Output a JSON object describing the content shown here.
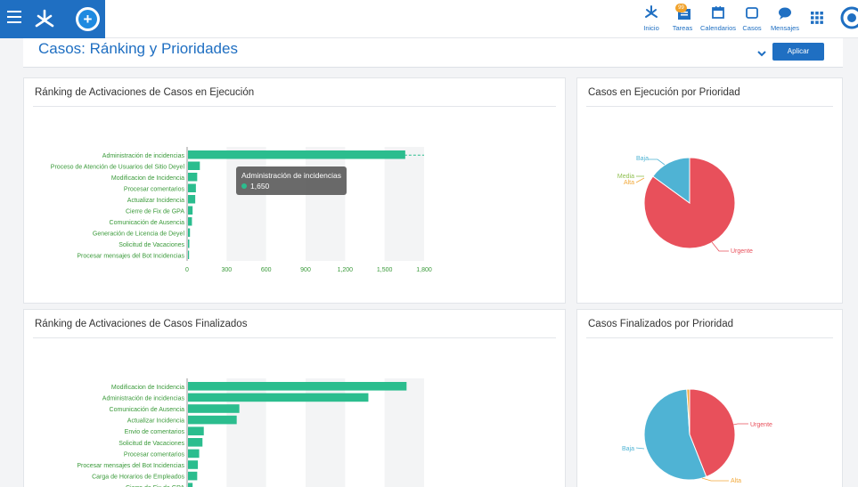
{
  "topbar": {
    "nav": [
      {
        "label": "Inicio",
        "icon": "home-icon"
      },
      {
        "label": "Tareas",
        "icon": "tasks-icon",
        "badge": "99"
      },
      {
        "label": "Calendarios",
        "icon": "calendar-icon"
      },
      {
        "label": "Casos",
        "icon": "cases-icon"
      },
      {
        "label": "Mensajes",
        "icon": "messages-icon"
      }
    ],
    "colors": {
      "brand": "#1f6fc2",
      "accent": "#1f8ae0",
      "badge": "#f1a22a"
    }
  },
  "header": {
    "title": "Casos: Ránking y Prioridades",
    "apply_label": "Aplicar"
  },
  "panels": {
    "top_left_title": "Ránking de Activaciones de Casos en Ejecución",
    "top_right_title": "Casos en Ejecución por Prioridad",
    "bottom_left_title": "Ránking de Activaciones de Casos Finalizados",
    "bottom_right_title": "Casos Finalizados por Prioridad"
  },
  "tooltip": {
    "label": "Administración de incidencias",
    "value": "1,650"
  },
  "chart_data": [
    {
      "type": "bar",
      "orientation": "horizontal",
      "title": "Ránking de Activaciones de Casos en Ejecución",
      "categories": [
        "Administración de incidencias",
        "Proceso de Atención de Usuarios del Sitio Deyel",
        "Modificacion de Incidencia",
        "Procesar comentarios",
        "Actualizar Incidencia",
        "Cierre de Fix de GPA",
        "Comunicación de Ausencia",
        "Generación de Licencia de Deyel",
        "Solicitud de Vacaciones",
        "Procesar mensajes del Bot Incidencias"
      ],
      "values": [
        1650,
        90,
        70,
        60,
        55,
        35,
        30,
        15,
        10,
        8
      ],
      "xlim": [
        0,
        1800
      ],
      "xticks": [
        "0",
        "300",
        "600",
        "900",
        "1,200",
        "1,500",
        "1,800"
      ],
      "color": "#2bbd8e"
    },
    {
      "type": "pie",
      "title": "Casos en Ejecución por Prioridad",
      "labels": [
        "Urgente",
        "Baja",
        "Media",
        "Alta"
      ],
      "values": [
        85,
        15,
        0,
        0
      ],
      "colors": [
        "#e8505b",
        "#4fb3d4",
        "#8fbf50",
        "#f2a93b"
      ]
    },
    {
      "type": "bar",
      "orientation": "horizontal",
      "title": "Ránking de Activaciones de Casos Finalizados",
      "categories": [
        "Modificacion de Incidencia",
        "Administración de incidencias",
        "Comunicación de Ausencia",
        "Actualizar Incidencia",
        "Envio de comentarios",
        "Solicitud de Vacaciones",
        "Procesar comentarios",
        "Procesar mensajes del Bot Incidencias",
        "Carga de Horarios de Empleados",
        "Cierre de Fix de GPA"
      ],
      "values": [
        1660,
        1370,
        390,
        370,
        120,
        110,
        85,
        75,
        70,
        35
      ],
      "xlim": [
        0,
        1800
      ],
      "color": "#2bbd8e"
    },
    {
      "type": "pie",
      "title": "Casos Finalizados por Prioridad",
      "labels": [
        "Urgente",
        "Baja",
        "Alta",
        "Media"
      ],
      "values": [
        44,
        55,
        1,
        0
      ],
      "colors": [
        "#e8505b",
        "#4fb3d4",
        "#f2a93b",
        "#8fbf50"
      ]
    }
  ]
}
